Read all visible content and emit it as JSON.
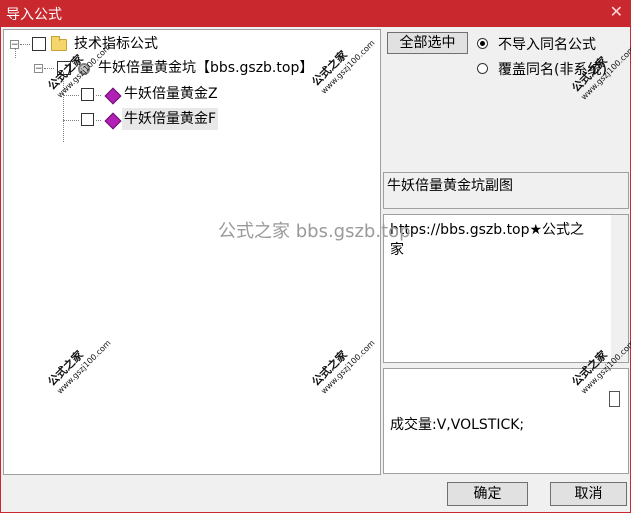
{
  "window": {
    "title": "导入公式",
    "close_glyph": "✕"
  },
  "tree": {
    "root": {
      "label": "技术指标公式",
      "expander": "−"
    },
    "group": {
      "label": "牛妖倍量黄金坑【bbs.gszb.top】",
      "expander": "−"
    },
    "items": [
      {
        "label": "牛妖倍量黄金Z",
        "checked": false
      },
      {
        "label": "牛妖倍量黄金F",
        "checked": false,
        "selected": true
      }
    ]
  },
  "controls": {
    "select_all_label": "全部选中",
    "radio_options": [
      {
        "label": "不导入同名公式",
        "checked": true
      },
      {
        "label": "覆盖同名(非系统)",
        "checked": false
      }
    ]
  },
  "details": {
    "formula_name": "牛妖倍量黄金坑副图",
    "description_line1": "https://bbs.gszb.top★公式之",
    "description_line2": "家",
    "code": "成交量:V,VOLSTICK;"
  },
  "footer": {
    "ok_label": "确定",
    "cancel_label": "取消"
  },
  "watermarks": {
    "brand": "公式之家",
    "site": "www.gszj100.com",
    "center": "公式之家 bbs.gszb.top"
  }
}
